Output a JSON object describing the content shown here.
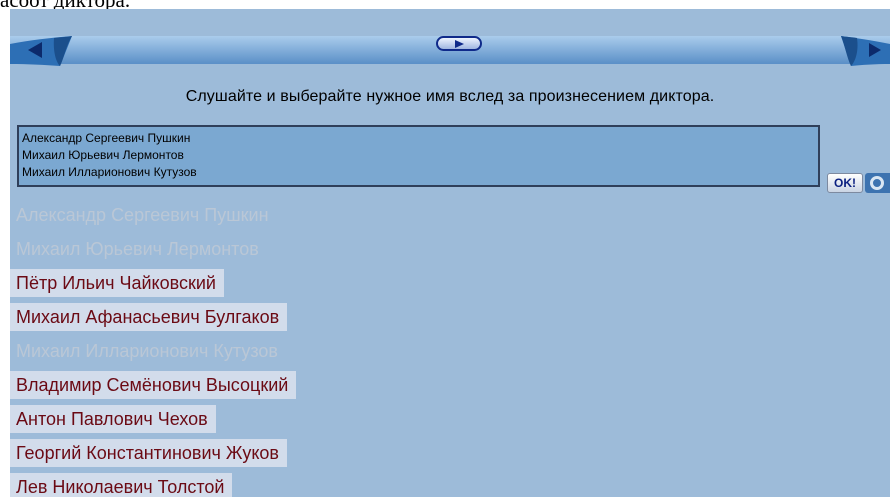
{
  "header": {
    "caption": "асоот диктора."
  },
  "toolbar": {
    "prev_icon": "prev-arrow-icon",
    "next_icon": "next-arrow-icon",
    "play_icon": "play-icon"
  },
  "instruction": "Слушайте и выберайте нужное имя вслед за произнесением диктора.",
  "answer": {
    "lines": [
      "Александр Сергеевич Пушкин",
      "Михаил Юрьевич Лермонтов",
      "Михаил Илларионович Кутузов"
    ]
  },
  "buttons": {
    "ok_label": "OK!",
    "undo_icon": "undo-icon"
  },
  "names": [
    {
      "label": "Александр Сергеевич Пушкин",
      "state": "used"
    },
    {
      "label": "Михаил Юрьевич Лермонтов",
      "state": "used"
    },
    {
      "label": "Пётр Ильич Чайковский",
      "state": "active"
    },
    {
      "label": "Михаил Афанасьевич Булгаков",
      "state": "active"
    },
    {
      "label": "Михаил Илларионович Кутузов",
      "state": "used"
    },
    {
      "label": "Владимир Семёнович Высоцкий",
      "state": "active"
    },
    {
      "label": "Антон Павлович Чехов",
      "state": "active"
    },
    {
      "label": "Георгий Константинович Жуков",
      "state": "active"
    },
    {
      "label": "Лев Николаевич Толстой",
      "state": "active"
    }
  ],
  "colors": {
    "panel_bg": "#9dbbd9",
    "active_item_bg": "#d2dceb",
    "active_item_text": "#6b0a14",
    "used_item_text": "#bac7d6",
    "answer_bg": "#7ba8d1"
  }
}
